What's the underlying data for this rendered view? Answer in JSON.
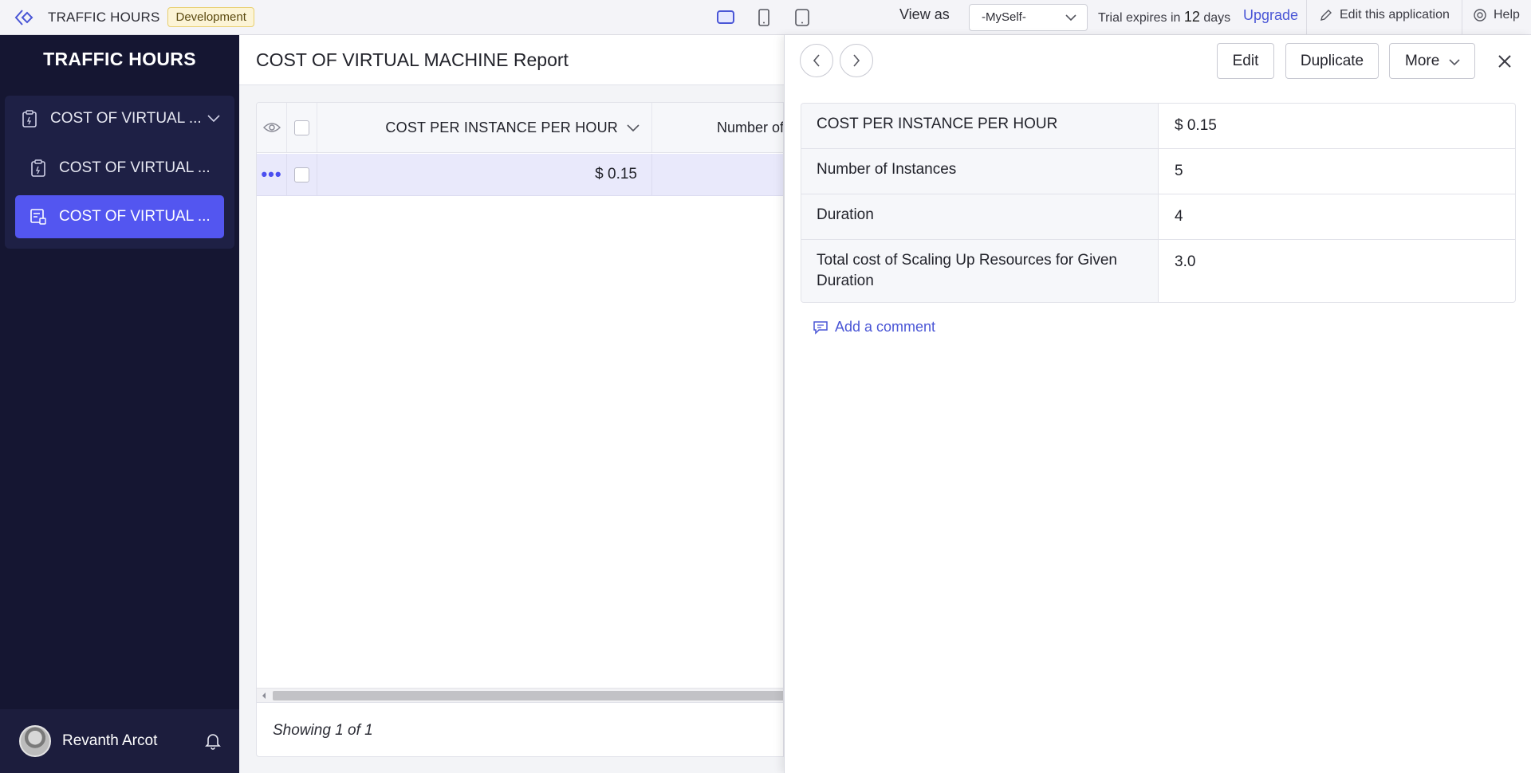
{
  "topbar": {
    "app_title": "TRAFFIC HOURS",
    "env_badge": "Development",
    "view_as_label": "View as",
    "view_as_value": "-MySelf-",
    "trial_prefix": "Trial expires in",
    "trial_days": "12",
    "trial_suffix": "days",
    "upgrade": "Upgrade",
    "edit_app": "Edit this application",
    "help": "Help"
  },
  "sidebar": {
    "title": "TRAFFIC HOURS",
    "parent_label": "COST OF VIRTUAL ...",
    "items": [
      {
        "label": "COST OF VIRTUAL ..."
      },
      {
        "label": "COST OF VIRTUAL ..."
      }
    ],
    "user_name": "Revanth Arcot"
  },
  "report": {
    "title": "COST OF VIRTUAL MACHINE Report",
    "columns": [
      "COST PER INSTANCE PER HOUR",
      "Number of In"
    ],
    "rows": [
      {
        "cost": "$ 0.15"
      }
    ],
    "footer": "Showing 1 of 1"
  },
  "detail": {
    "buttons": {
      "edit": "Edit",
      "duplicate": "Duplicate",
      "more": "More"
    },
    "fields": [
      {
        "label": "COST PER INSTANCE PER HOUR",
        "value": "$ 0.15"
      },
      {
        "label": "Number of Instances",
        "value": "5"
      },
      {
        "label": "Duration",
        "value": "4"
      },
      {
        "label": "Total cost of Scaling Up Resources for Given Duration",
        "value": "3.0"
      }
    ],
    "add_comment": "Add a comment"
  },
  "colors": {
    "accent": "#5356f0",
    "link": "#4a56d6",
    "sidebar_bg": "#151632"
  }
}
